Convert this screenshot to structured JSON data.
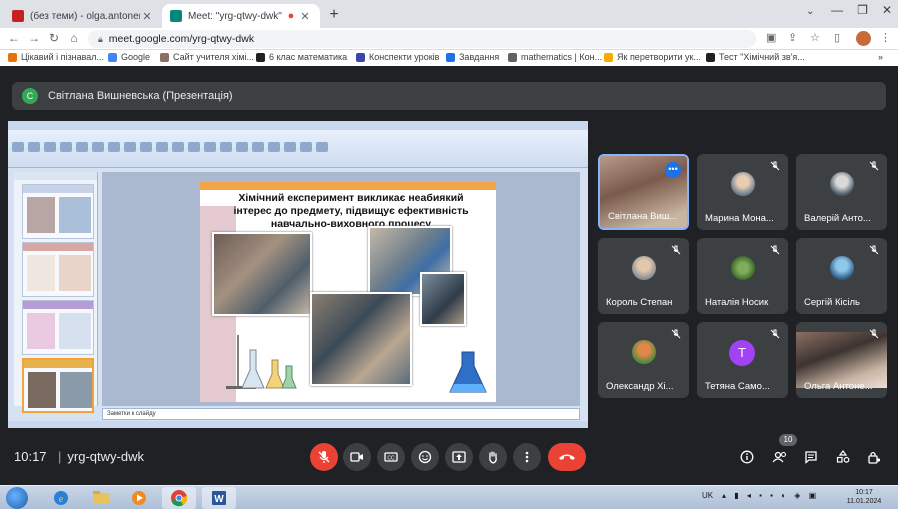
{
  "browser": {
    "tabs": [
      {
        "title": "(без теми) - olga.antonencko@",
        "favicon_color": "#c5221f"
      },
      {
        "title": "Meet: \"yrg-qtwy-dwk\"",
        "favicon_color": "#00897b"
      }
    ],
    "new_tab": "+",
    "url": "meet.google.com/yrg-qtwy-dwk",
    "bookmarks": [
      {
        "label": "Цікавий і пізнавал...",
        "icon_color": "#e8710a"
      },
      {
        "label": "Google",
        "icon_color": "#4285f4"
      },
      {
        "label": "Сайт учителя хімі...",
        "icon_color": "#8d6e63"
      },
      {
        "label": "6 клас математика",
        "icon_color": "#202124"
      },
      {
        "label": "Конспекти уроків",
        "icon_color": "#3949ab"
      },
      {
        "label": "Завдання",
        "icon_color": "#1a73e8"
      },
      {
        "label": "mathematics | Кон...",
        "icon_color": "#5f6368"
      },
      {
        "label": "Як перетворити ук...",
        "icon_color": "#f9ab00"
      },
      {
        "label": "Тест \"Хімічний зв'я...",
        "icon_color": "#202124"
      }
    ]
  },
  "meet": {
    "presenter": {
      "initial": "С",
      "label": "Світлана Вишневська (Презентація)"
    },
    "slide": {
      "title": "Хімічний експеримент викликає неабиякий інтерес до предмету, підвищує ефективність навчально-виховного процесу",
      "notes": "Заметки к слайду"
    },
    "participants": [
      {
        "name": "Світлана Виш...",
        "type": "video"
      },
      {
        "name": "Марина Мона...",
        "type": "photo"
      },
      {
        "name": "Валерій Анто...",
        "type": "photo"
      },
      {
        "name": "Король Степан",
        "type": "photo"
      },
      {
        "name": "Наталія Носик",
        "type": "photo"
      },
      {
        "name": "Сергій Кісіль",
        "type": "photo"
      },
      {
        "name": "Олександр Хі...",
        "type": "photo"
      },
      {
        "name": "Тетяна Само...",
        "type": "letter",
        "letter": "Т"
      },
      {
        "name": "Ольга Антоне...",
        "type": "video"
      }
    ],
    "time": "10:17",
    "meeting_code": "yrg-qtwy-dwk",
    "people_count": "10"
  },
  "taskbar": {
    "lang": "UK",
    "time": "10:17",
    "date": "11.01.2024"
  },
  "colors": {
    "meet_bg": "#202124",
    "tile_bg": "#3c4043",
    "red": "#ea4335",
    "accent": "#8ab4f8"
  }
}
